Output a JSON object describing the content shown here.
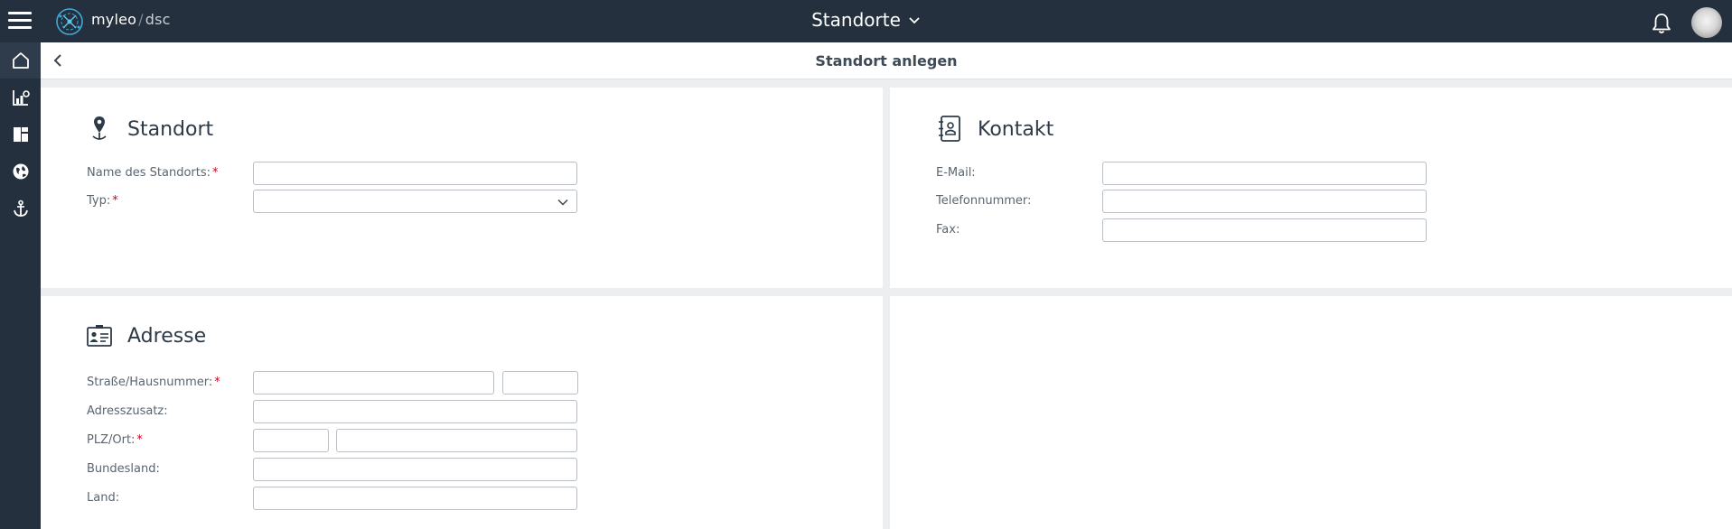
{
  "app": {
    "brand_name": "myleo",
    "brand_separator": "/",
    "brand_product": "dsc",
    "module_title": "Standorte",
    "menu_icon": "hamburger-menu-icon",
    "notification_icon": "bell-icon"
  },
  "sidebar": {
    "items": [
      {
        "icon": "home-icon",
        "active": true
      },
      {
        "icon": "chart-settings-icon",
        "active": false
      },
      {
        "icon": "dashboard-layout-icon",
        "active": false
      },
      {
        "icon": "globe-icon",
        "active": false
      },
      {
        "icon": "anchor-icon",
        "active": false
      }
    ]
  },
  "page": {
    "title": "Standort anlegen",
    "back_icon": "chevron-left-icon"
  },
  "sections": {
    "standort": {
      "title": "Standort",
      "icon": "location-pin-icon",
      "fields": {
        "name": {
          "label": "Name des Standorts:",
          "required_mark": "*",
          "value": ""
        },
        "typ": {
          "label": "Typ:",
          "required_mark": "*",
          "value": ""
        }
      }
    },
    "kontakt": {
      "title": "Kontakt",
      "icon": "address-book-icon",
      "fields": {
        "email": {
          "label": "E-Mail:",
          "value": ""
        },
        "telefon": {
          "label": "Telefonnummer:",
          "value": ""
        },
        "fax": {
          "label": "Fax:",
          "value": ""
        }
      }
    },
    "adresse": {
      "title": "Adresse",
      "icon": "id-card-icon",
      "fields": {
        "strasse": {
          "label": "Straße/Hausnummer:",
          "required_mark": "*",
          "street_value": "",
          "number_value": ""
        },
        "zusatz": {
          "label": "Adresszusatz:",
          "value": ""
        },
        "plz_ort": {
          "label": "PLZ/Ort:",
          "required_mark": "*",
          "plz_value": "",
          "ort_value": ""
        },
        "bundesland": {
          "label": "Bundesland:",
          "value": ""
        },
        "land": {
          "label": "Land:",
          "value": ""
        }
      }
    }
  },
  "colors": {
    "topbar": "#24303d",
    "required": "#d0021b",
    "background": "#eceeef",
    "card": "#ffffff"
  }
}
